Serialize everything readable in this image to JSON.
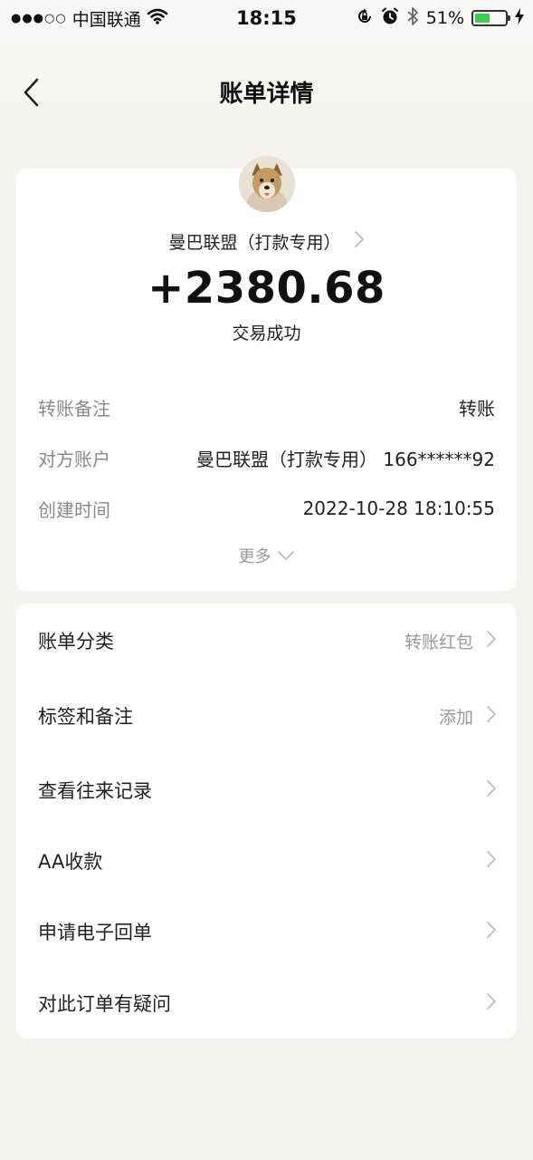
{
  "status_bar": {
    "signal": "●●●○○",
    "carrier": "中国联通",
    "time": "18:15",
    "battery": "51%",
    "battery_level": 0.51,
    "icons": [
      "wifi-icon",
      "orientation-lock-icon",
      "alarm-icon",
      "bluetooth-icon",
      "battery-icon",
      "charging-icon"
    ]
  },
  "nav": {
    "title": "账单详情",
    "back_icon": "chevron-left-icon"
  },
  "summary": {
    "payee": "曼巴联盟（打款专用）",
    "amount": "+2380.68",
    "status": "交易成功",
    "details": [
      {
        "label": "转账备注",
        "value": "转账"
      },
      {
        "label": "对方账户",
        "value": "曼巴联盟（打款专用） 166******92"
      },
      {
        "label": "创建时间",
        "value": "2022-10-28 18:10:55"
      }
    ],
    "more": "更多"
  },
  "menu": [
    {
      "label": "账单分类",
      "value": "转账红包"
    },
    {
      "label": "标签和备注",
      "value": "添加"
    },
    {
      "label": "查看往来记录",
      "value": ""
    },
    {
      "label": "AA收款",
      "value": ""
    },
    {
      "label": "申请电子回单",
      "value": ""
    },
    {
      "label": "对此订单有疑问",
      "value": ""
    }
  ],
  "colors": {
    "page_bg": "#f4f3ef",
    "card_bg": "#ffffff",
    "muted_text": "#8a8a8a",
    "battery_green": "#3ccf4e"
  }
}
